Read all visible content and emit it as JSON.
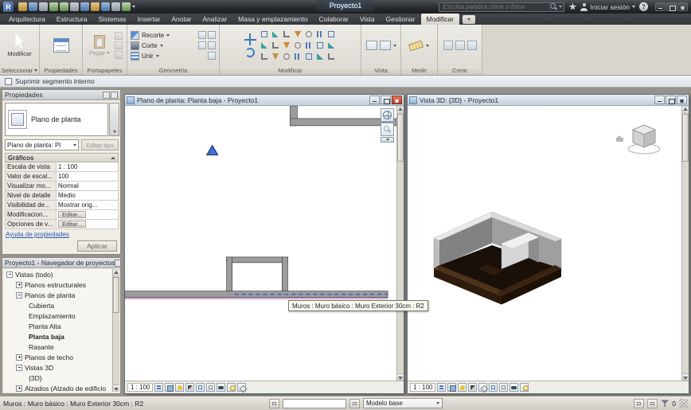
{
  "titlebar": {
    "app_glyph": "R",
    "doc_title": "Proyecto1",
    "search_placeholder": "Escriba palabra clave o frase",
    "sign_in_label": "Iniciar sesión",
    "help_glyph": "?"
  },
  "tabs": {
    "items": [
      "Arquitectura",
      "Estructura",
      "Sistemas",
      "Insertar",
      "Anotar",
      "Analizar",
      "Masa y emplazamiento",
      "Colaborar",
      "Vista",
      "Gestionar",
      "Modificar"
    ]
  },
  "ribbon": {
    "select_panel_label": "Seleccionar",
    "modify_button_label": "Modificar",
    "properties_panel_label": "Propiedades",
    "clipboard_panel_label": "Portapapeles",
    "paste_button_label": "Pegar",
    "geometry_panel_label": "Geometría",
    "cope_label": "Recorte",
    "cut_label": "Corte",
    "join_label": "Unir",
    "modify_panel_label": "Modificar",
    "view_panel_label": "Vista",
    "measure_panel_label": "Medir",
    "create_panel_label": "Crear"
  },
  "options_bar": {
    "suppress_segment_label": "Suprimir segmento interno"
  },
  "properties_palette": {
    "title": "Propiedades",
    "type_name": "Plano de planta",
    "type_selector_value": "Plano de planta: Pl",
    "edit_type_label": "Editar tipo",
    "section_graphics": "Gráficos",
    "rows": [
      {
        "label": "Escala de vista",
        "value": "1 : 100"
      },
      {
        "label": "Valor de escal...",
        "value": "100"
      },
      {
        "label": "Visualizar mo...",
        "value": "Normal"
      },
      {
        "label": "Nivel de detalle",
        "value": "Medio"
      },
      {
        "label": "Visibilidad de...",
        "value": "Mostrar orig..."
      },
      {
        "label": "Modificacion...",
        "value": "Editar..."
      },
      {
        "label": "Opciones de v...",
        "value": "Editar..."
      }
    ],
    "help_link": "Ayuda de propiedades",
    "apply_label": "Aplicar"
  },
  "project_browser": {
    "title": "Proyecto1 - Navegador de proyectos",
    "items": [
      "Vistas (todo)",
      "Planos estructurales",
      "Planos de planta",
      "Cubierta",
      "Emplazamiento",
      "Planta Alta",
      "Planta baja",
      "Rasante",
      "Planos de techo",
      "Vistas 3D",
      "{3D}",
      "Alzados (Alzado de edificio"
    ]
  },
  "plan_window": {
    "title": "Plano de planta: Planta baja - Proyecto1",
    "scale": "1 : 100"
  },
  "view3d_window": {
    "title": "Vista 3D: {3D} - Proyecto1",
    "scale": "1 : 100"
  },
  "tooltip": {
    "text": "Muros : Muro básico : Muro Exterior 30cm : R2"
  },
  "statusbar": {
    "message": "Muros : Muro básico : Muro Exterior 30cm : R2",
    "design_option": "Modelo base",
    "filter_count": "0"
  },
  "colors": {
    "wall_gray": "#9c9c9c",
    "selection_dash_blue": "#3a5fd0",
    "reference_magenta": "#b44fb4",
    "active_close_red": "#b93a28",
    "ribbon_bg": "#d8d5cd"
  }
}
